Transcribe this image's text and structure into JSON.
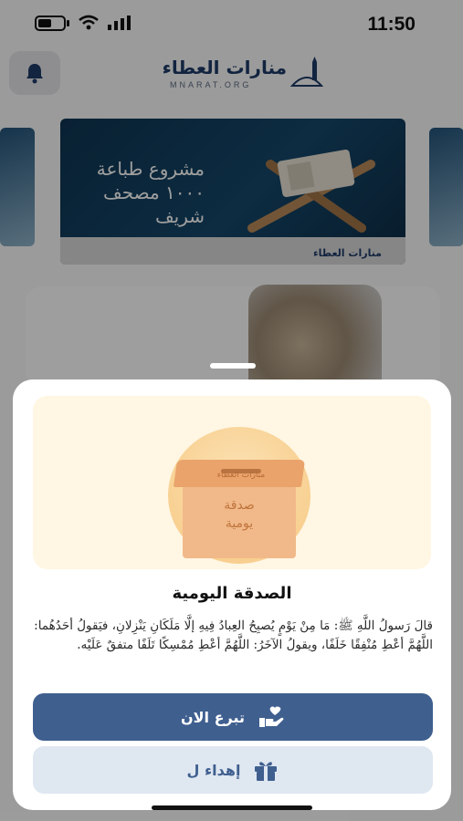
{
  "status_bar": {
    "time": "11:50"
  },
  "header": {
    "logo_name": "منارات العطاء",
    "logo_sub": "MNARAT.ORG"
  },
  "banner": {
    "text": "مشروع طباعة ١٠٠٠ مصحف شريف",
    "footer_logo": "منارات العطاء"
  },
  "sheet": {
    "box_logo": "منارات العطاء",
    "box_label_line1": "صدقة",
    "box_label_line2": "يومية",
    "title": "الصدقة اليومية",
    "hadith": "قالَ رَسولُ اللَّهِ ﷺ: مَا مِنْ يَوْمٍ يُصبِحُ العِبادُ فِيهِ إلَّا مَلَكَانِ يَنْزِلانِ، فيَقولُ أحَدُهُما: اللَّهُمَّ أعْطِ مُنْفِقًا خَلَفًا، ويقولُ الآخَرُ: اللَّهُمَّ أعْطِ مُمْسِكًا تَلَفًا متفقٌ عَلَيْه.",
    "donate_label": "تبرع الان",
    "gift_label": "إهداء ل"
  },
  "colors": {
    "primary": "#3f5f8f",
    "secondary_bg": "#dfe7f1",
    "hero_bg": "#fff6e3"
  },
  "icons": {
    "bell": "bell-icon",
    "donate": "hand-heart-icon",
    "gift": "gift-icon"
  }
}
